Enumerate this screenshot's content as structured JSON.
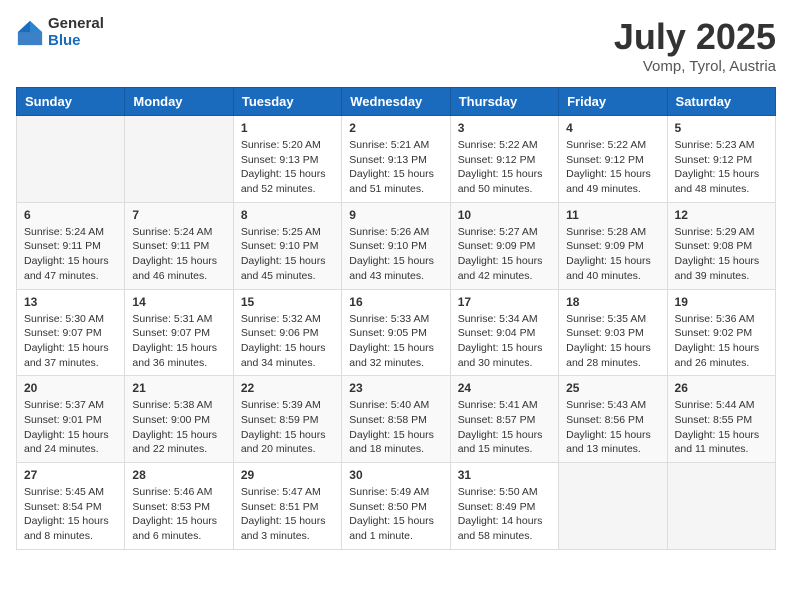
{
  "header": {
    "logo_general": "General",
    "logo_blue": "Blue",
    "month_title": "July 2025",
    "location": "Vomp, Tyrol, Austria"
  },
  "days_of_week": [
    "Sunday",
    "Monday",
    "Tuesday",
    "Wednesday",
    "Thursday",
    "Friday",
    "Saturday"
  ],
  "weeks": [
    [
      {
        "day": "",
        "info": ""
      },
      {
        "day": "",
        "info": ""
      },
      {
        "day": "1",
        "info": "Sunrise: 5:20 AM\nSunset: 9:13 PM\nDaylight: 15 hours\nand 52 minutes."
      },
      {
        "day": "2",
        "info": "Sunrise: 5:21 AM\nSunset: 9:13 PM\nDaylight: 15 hours\nand 51 minutes."
      },
      {
        "day": "3",
        "info": "Sunrise: 5:22 AM\nSunset: 9:12 PM\nDaylight: 15 hours\nand 50 minutes."
      },
      {
        "day": "4",
        "info": "Sunrise: 5:22 AM\nSunset: 9:12 PM\nDaylight: 15 hours\nand 49 minutes."
      },
      {
        "day": "5",
        "info": "Sunrise: 5:23 AM\nSunset: 9:12 PM\nDaylight: 15 hours\nand 48 minutes."
      }
    ],
    [
      {
        "day": "6",
        "info": "Sunrise: 5:24 AM\nSunset: 9:11 PM\nDaylight: 15 hours\nand 47 minutes."
      },
      {
        "day": "7",
        "info": "Sunrise: 5:24 AM\nSunset: 9:11 PM\nDaylight: 15 hours\nand 46 minutes."
      },
      {
        "day": "8",
        "info": "Sunrise: 5:25 AM\nSunset: 9:10 PM\nDaylight: 15 hours\nand 45 minutes."
      },
      {
        "day": "9",
        "info": "Sunrise: 5:26 AM\nSunset: 9:10 PM\nDaylight: 15 hours\nand 43 minutes."
      },
      {
        "day": "10",
        "info": "Sunrise: 5:27 AM\nSunset: 9:09 PM\nDaylight: 15 hours\nand 42 minutes."
      },
      {
        "day": "11",
        "info": "Sunrise: 5:28 AM\nSunset: 9:09 PM\nDaylight: 15 hours\nand 40 minutes."
      },
      {
        "day": "12",
        "info": "Sunrise: 5:29 AM\nSunset: 9:08 PM\nDaylight: 15 hours\nand 39 minutes."
      }
    ],
    [
      {
        "day": "13",
        "info": "Sunrise: 5:30 AM\nSunset: 9:07 PM\nDaylight: 15 hours\nand 37 minutes."
      },
      {
        "day": "14",
        "info": "Sunrise: 5:31 AM\nSunset: 9:07 PM\nDaylight: 15 hours\nand 36 minutes."
      },
      {
        "day": "15",
        "info": "Sunrise: 5:32 AM\nSunset: 9:06 PM\nDaylight: 15 hours\nand 34 minutes."
      },
      {
        "day": "16",
        "info": "Sunrise: 5:33 AM\nSunset: 9:05 PM\nDaylight: 15 hours\nand 32 minutes."
      },
      {
        "day": "17",
        "info": "Sunrise: 5:34 AM\nSunset: 9:04 PM\nDaylight: 15 hours\nand 30 minutes."
      },
      {
        "day": "18",
        "info": "Sunrise: 5:35 AM\nSunset: 9:03 PM\nDaylight: 15 hours\nand 28 minutes."
      },
      {
        "day": "19",
        "info": "Sunrise: 5:36 AM\nSunset: 9:02 PM\nDaylight: 15 hours\nand 26 minutes."
      }
    ],
    [
      {
        "day": "20",
        "info": "Sunrise: 5:37 AM\nSunset: 9:01 PM\nDaylight: 15 hours\nand 24 minutes."
      },
      {
        "day": "21",
        "info": "Sunrise: 5:38 AM\nSunset: 9:00 PM\nDaylight: 15 hours\nand 22 minutes."
      },
      {
        "day": "22",
        "info": "Sunrise: 5:39 AM\nSunset: 8:59 PM\nDaylight: 15 hours\nand 20 minutes."
      },
      {
        "day": "23",
        "info": "Sunrise: 5:40 AM\nSunset: 8:58 PM\nDaylight: 15 hours\nand 18 minutes."
      },
      {
        "day": "24",
        "info": "Sunrise: 5:41 AM\nSunset: 8:57 PM\nDaylight: 15 hours\nand 15 minutes."
      },
      {
        "day": "25",
        "info": "Sunrise: 5:43 AM\nSunset: 8:56 PM\nDaylight: 15 hours\nand 13 minutes."
      },
      {
        "day": "26",
        "info": "Sunrise: 5:44 AM\nSunset: 8:55 PM\nDaylight: 15 hours\nand 11 minutes."
      }
    ],
    [
      {
        "day": "27",
        "info": "Sunrise: 5:45 AM\nSunset: 8:54 PM\nDaylight: 15 hours\nand 8 minutes."
      },
      {
        "day": "28",
        "info": "Sunrise: 5:46 AM\nSunset: 8:53 PM\nDaylight: 15 hours\nand 6 minutes."
      },
      {
        "day": "29",
        "info": "Sunrise: 5:47 AM\nSunset: 8:51 PM\nDaylight: 15 hours\nand 3 minutes."
      },
      {
        "day": "30",
        "info": "Sunrise: 5:49 AM\nSunset: 8:50 PM\nDaylight: 15 hours\nand 1 minute."
      },
      {
        "day": "31",
        "info": "Sunrise: 5:50 AM\nSunset: 8:49 PM\nDaylight: 14 hours\nand 58 minutes."
      },
      {
        "day": "",
        "info": ""
      },
      {
        "day": "",
        "info": ""
      }
    ]
  ]
}
